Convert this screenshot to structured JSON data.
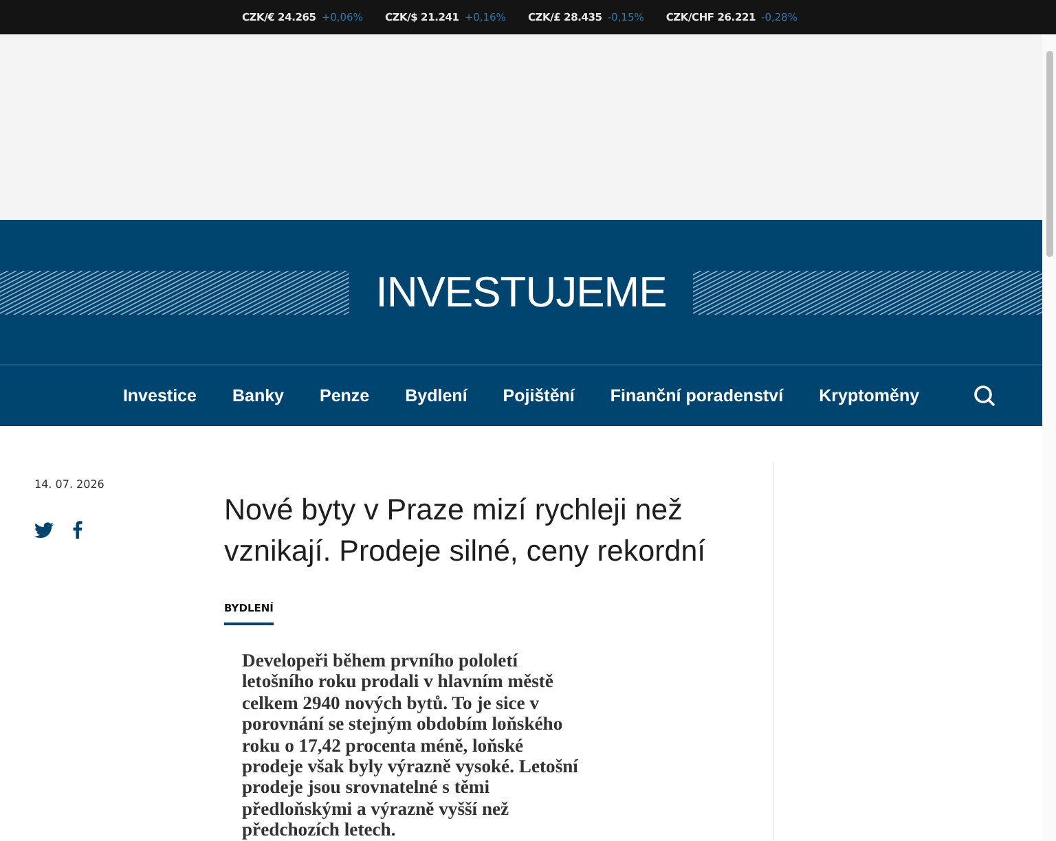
{
  "ticker": [
    {
      "pair": "CZK/€ 24.265",
      "change": "+0,06%"
    },
    {
      "pair": "CZK/$ 21.241",
      "change": "+0,16%"
    },
    {
      "pair": "CZK/£ 28.435",
      "change": "-0,15%"
    },
    {
      "pair": "CZK/CHF 26.221",
      "change": "-0,28%"
    }
  ],
  "logo": "INVESTUJEME",
  "nav": [
    "Investice",
    "Banky",
    "Penze",
    "Bydlení",
    "Pojištění",
    "Finanční poradenství",
    "Kryptoměny"
  ],
  "article": {
    "date": "14. 07. 2026",
    "title": "Nové byty v Praze mizí rychleji než vznikají. Prodeje silné, ceny rekordní",
    "category": "BYDLENÍ",
    "lead": "Developeři během prvního pololetí letošního roku prodali v hlavním městě celkem 2940 nových bytů. To je sice v porovnání se stejným obdobím loňského roku o 17,42 procenta méně, loňské prodeje však byly výrazně vysoké. Letošní prodeje jsou srovnatelné s těmi předloňskými a výrazně vyšší než předchozích letech."
  }
}
